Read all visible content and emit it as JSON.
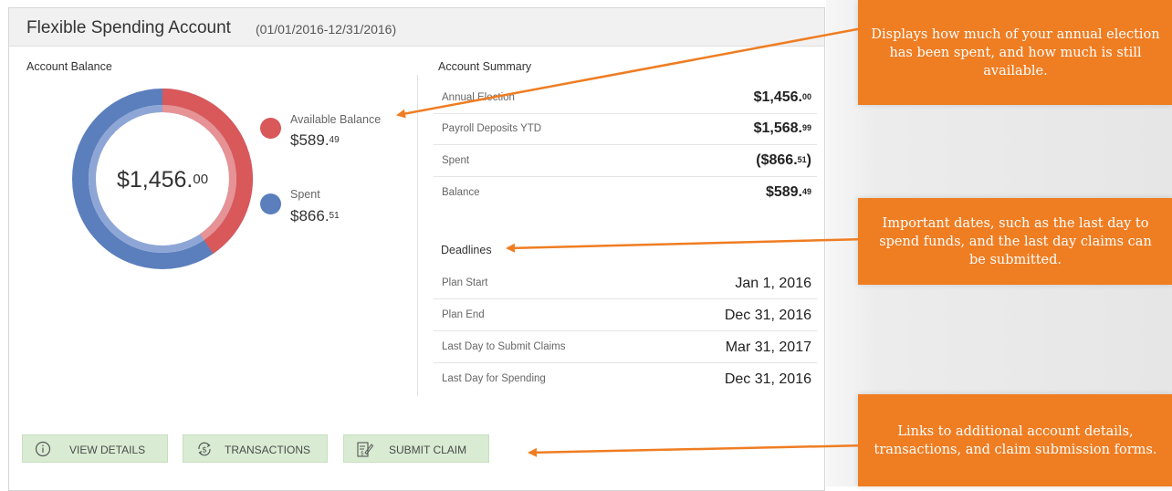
{
  "card": {
    "title": "Flexible Spending Account",
    "period": "(01/01/2016-12/31/2016)"
  },
  "balance": {
    "heading": "Account Balance",
    "total_main": "$1,456.",
    "total_cents": "00",
    "available": {
      "label": "Available Balance",
      "main": "$589.",
      "cents": "49",
      "color": "#d9585a",
      "fraction": 0.405
    },
    "spent": {
      "label": "Spent",
      "main": "$866.",
      "cents": "51",
      "color": "#5b7fbd",
      "fraction": 0.595
    }
  },
  "summary": {
    "heading": "Account Summary",
    "rows": [
      {
        "label": "Annual Election",
        "main": "$1,456.",
        "cents": "00",
        "suffix": ""
      },
      {
        "label": "Payroll Deposits YTD",
        "main": "$1,568.",
        "cents": "99",
        "suffix": ""
      },
      {
        "label": "Spent",
        "main": "($866.",
        "cents": "51",
        "suffix": ")"
      },
      {
        "label": "Balance",
        "main": "$589.",
        "cents": "49",
        "suffix": ""
      }
    ]
  },
  "deadlines": {
    "heading": "Deadlines",
    "rows": [
      {
        "label": "Plan Start",
        "value": "Jan 1, 2016"
      },
      {
        "label": "Plan End",
        "value": "Dec 31, 2016"
      },
      {
        "label": "Last Day to Submit Claims",
        "value": "Mar 31, 2017"
      },
      {
        "label": "Last Day for Spending",
        "value": "Dec 31, 2016"
      }
    ]
  },
  "buttons": {
    "view_details": "VIEW DETAILS",
    "transactions": "TRANSACTIONS",
    "submit_claim": "SUBMIT CLAIM"
  },
  "callouts": {
    "balance": "Displays how much of your annual election has been spent, and how much is still available.",
    "deadlines": "Important dates, such as the last day to spend funds, and the last day claims can be submitted.",
    "links": "Links to additional account details, transactions, and claim submission forms."
  },
  "colors": {
    "callout": "#ef7d22",
    "button_bg": "#d9ecd3",
    "available": "#d9585a",
    "spent": "#5b7fbd"
  },
  "icons": {
    "view_details": "info-circle-icon",
    "transactions": "dollar-cycle-icon",
    "submit_claim": "form-pen-icon"
  }
}
